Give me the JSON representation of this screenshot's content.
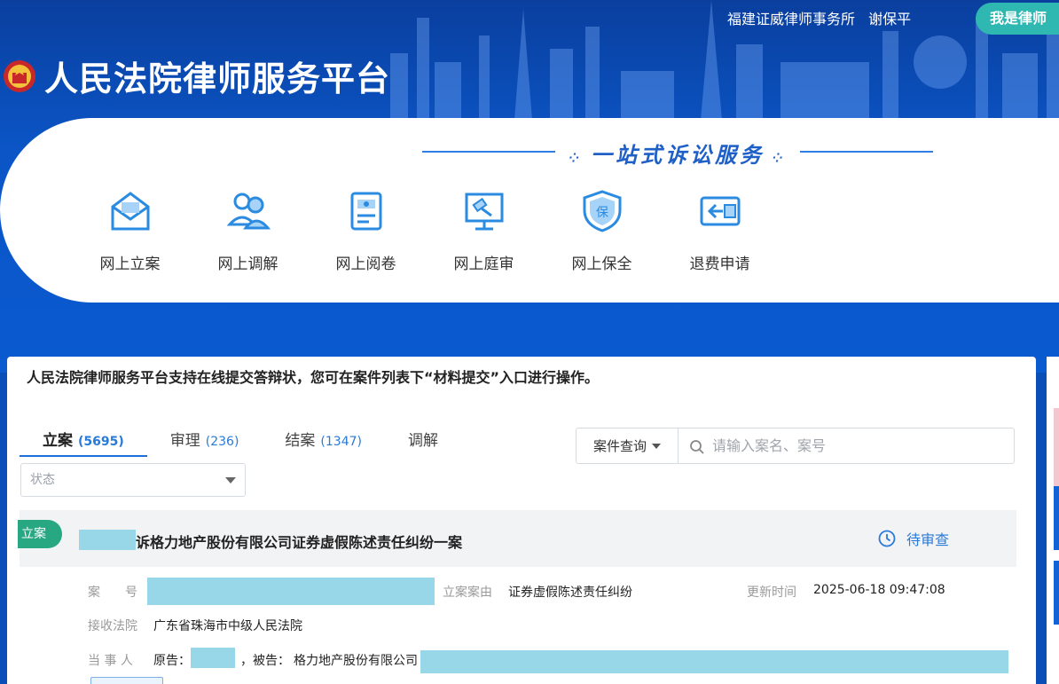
{
  "header": {
    "firm": "福建证威律师事务所",
    "user": "谢保平",
    "lawyer_button": "我是律师",
    "title": "人民法院律师服务平台"
  },
  "services_panel": {
    "slogan": "一站式诉讼服务",
    "items": [
      {
        "label": "网上立案",
        "icon": "envelope-icon"
      },
      {
        "label": "网上调解",
        "icon": "people-icon"
      },
      {
        "label": "网上阅卷",
        "icon": "document-view-icon"
      },
      {
        "label": "网上庭审",
        "icon": "gavel-screen-icon"
      },
      {
        "label": "网上保全",
        "icon": "shield-icon"
      },
      {
        "label": "退费申请",
        "icon": "refund-icon"
      }
    ]
  },
  "notice": "人民法院律师服务平台支持在线提交答辩状，您可在案件列表下“材料提交”入口进行操作。",
  "tabs": [
    {
      "label": "立案",
      "count": "(5695)",
      "active": true
    },
    {
      "label": "审理",
      "count": "(236)",
      "active": false
    },
    {
      "label": "结案",
      "count": "(1347)",
      "active": false
    },
    {
      "label": "调解",
      "count": "",
      "active": false
    }
  ],
  "search": {
    "type_label": "案件查询",
    "placeholder": "请输入案名、案号"
  },
  "status_filter": {
    "placeholder": "状态"
  },
  "case": {
    "badge": "立案",
    "title": "诉格力地产股份有限公司证券虚假陈述责任纠纷一案",
    "status": "待审查",
    "case_no_label": "案　　号",
    "cause_label": "立案案由",
    "cause_value": "证券虚假陈述责任纠纷",
    "update_label": "更新时间",
    "update_value": "2025-06-18 09:47:08",
    "court_label": "接收法院",
    "court_value": "广东省珠海市中级人民法院",
    "parties_label": "当 事 人",
    "plaintiff_prefix": "原告：",
    "defendant_prefix": "，被告：",
    "defendant_value": "格力地产股份有限公司"
  },
  "colors": {
    "brand_blue": "#0b55c6",
    "accent_blue": "#2a7ad8",
    "badge_green": "#27a883",
    "redaction": "#97d7e8"
  }
}
